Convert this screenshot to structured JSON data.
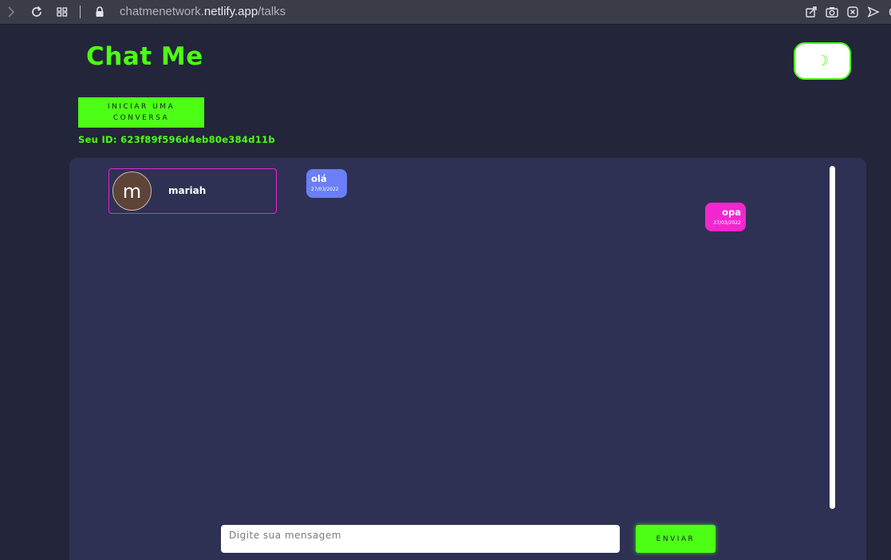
{
  "browser": {
    "url_prefix": "chatmenetwork.",
    "url_domain": "netlify.app",
    "url_path": "/talks"
  },
  "app": {
    "title": "Chat Me",
    "theme_toggle_icon": "☽",
    "start_conversation_label": "INICIAR UMA CONVERSA",
    "user_id_text": "Seu ID: 623f89f596d4eb80e384d11b"
  },
  "contacts": [
    {
      "avatar_letter": "m",
      "name": "mariah"
    }
  ],
  "messages": [
    {
      "text": "olá",
      "date": "27/03/2022",
      "direction": "incoming"
    },
    {
      "text": "opa",
      "date": "27/03/2022",
      "direction": "outgoing"
    }
  ],
  "composer": {
    "placeholder": "Digite sua mensagem",
    "send_label": "ENVIAR"
  },
  "colors": {
    "accent": "#4cff14",
    "background": "#23253a",
    "panel": "#2e3153",
    "incoming_bubble": "#6b7ff6",
    "outgoing_bubble": "#f227cf",
    "contact_border": "#e625d1"
  },
  "icons": {
    "back": "chevron-right-icon",
    "reload": "reload-icon",
    "tabs": "grid-icon",
    "lock": "lock-icon",
    "share": "share-icon",
    "camera": "camera-icon",
    "close": "close-circle-icon",
    "send": "send-icon"
  }
}
